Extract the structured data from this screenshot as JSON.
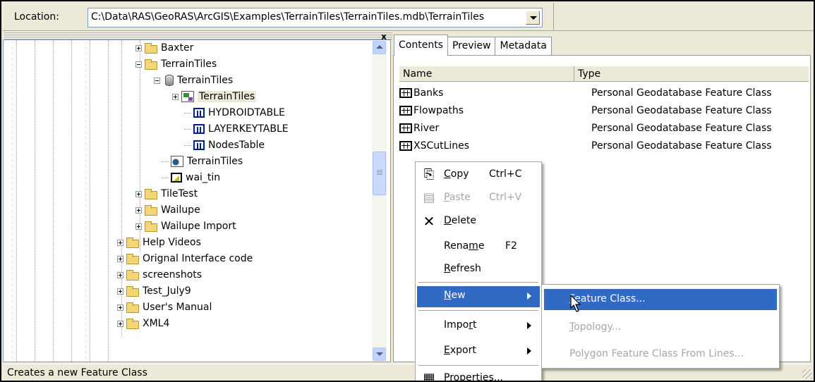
{
  "location": {
    "label": "Location:",
    "path": "C:\\Data\\RAS\\GeoRAS\\ArcGIS\\Examples\\TerrainTiles\\TerrainTiles.mdb\\TerrainTiles"
  },
  "tree": {
    "items": [
      {
        "label": "Baxter",
        "icon": "folder-icon",
        "expander": "plus"
      },
      {
        "label": "TerrainTiles",
        "icon": "folder-icon",
        "expander": "minus"
      },
      {
        "label": "TerrainTiles",
        "icon": "geodatabase-icon",
        "expander": "minus"
      },
      {
        "label": "TerrainTiles",
        "icon": "feature-dataset-icon",
        "expander": "plus",
        "selected": true
      },
      {
        "label": "HYDROIDTABLE",
        "icon": "table-icon"
      },
      {
        "label": "LAYERKEYTABLE",
        "icon": "table-icon"
      },
      {
        "label": "NodesTable",
        "icon": "table-icon"
      },
      {
        "label": "TerrainTiles",
        "icon": "terrain-icon"
      },
      {
        "label": "wai_tin",
        "icon": "tin-icon"
      },
      {
        "label": "TileTest",
        "icon": "folder-icon",
        "expander": "plus"
      },
      {
        "label": "Wailupe",
        "icon": "folder-icon",
        "expander": "plus"
      },
      {
        "label": "Wailupe Import",
        "icon": "folder-icon",
        "expander": "plus"
      },
      {
        "label": "Help Videos",
        "icon": "folder-icon",
        "expander": "plus"
      },
      {
        "label": "Orignal Interface code",
        "icon": "folder-icon",
        "expander": "plus"
      },
      {
        "label": "screenshots",
        "icon": "folder-icon",
        "expander": "plus"
      },
      {
        "label": "Test_July9",
        "icon": "folder-icon",
        "expander": "plus"
      },
      {
        "label": "User's Manual",
        "icon": "folder-icon",
        "expander": "plus"
      },
      {
        "label": "XML4",
        "icon": "folder-icon",
        "expander": "plus"
      }
    ],
    "close_glyph": "x"
  },
  "tabs": [
    {
      "label": "Contents",
      "active": true
    },
    {
      "label": "Preview"
    },
    {
      "label": "Metadata"
    }
  ],
  "list": {
    "columns": {
      "name": "Name",
      "type": "Type"
    },
    "rows": [
      {
        "name": "Banks",
        "type": "Personal Geodatabase Feature Class"
      },
      {
        "name": "Flowpaths",
        "type": "Personal Geodatabase Feature Class"
      },
      {
        "name": "River",
        "type": "Personal Geodatabase Feature Class"
      },
      {
        "name": "XSCutLines",
        "type": "Personal Geodatabase Feature Class"
      }
    ]
  },
  "context_menu": {
    "copy": {
      "pre": "",
      "u": "C",
      "post": "opy",
      "shortcut": "Ctrl+C"
    },
    "paste": {
      "pre": "",
      "u": "P",
      "post": "aste",
      "shortcut": "Ctrl+V"
    },
    "delete": {
      "pre": "",
      "u": "D",
      "post": "elete"
    },
    "rename": {
      "pre": "Rena",
      "u": "m",
      "post": "e",
      "shortcut": "F2"
    },
    "refresh": {
      "pre": "",
      "u": "R",
      "post": "efresh"
    },
    "new": {
      "pre": "",
      "u": "N",
      "post": "ew"
    },
    "import": {
      "pre": "Impo",
      "u": "r",
      "post": "t"
    },
    "export": {
      "pre": "",
      "u": "E",
      "post": "xport"
    },
    "properties": {
      "pre": "Proper",
      "u": "t",
      "post": "ies..."
    }
  },
  "submenu": {
    "feature_class": {
      "pre": "",
      "u": "F",
      "post": "eature Class..."
    },
    "topology": {
      "pre": "",
      "u": "T",
      "post": "opology..."
    },
    "polygon": {
      "pre": "Polygon Feature Class From Lines...",
      "u": "",
      "post": ""
    }
  },
  "status": {
    "text": "Creates a new Feature Class"
  },
  "colors": {
    "highlight": "#316ac5",
    "window_bg": "#ece9d8",
    "disabled_text": "#a7a6aa"
  }
}
